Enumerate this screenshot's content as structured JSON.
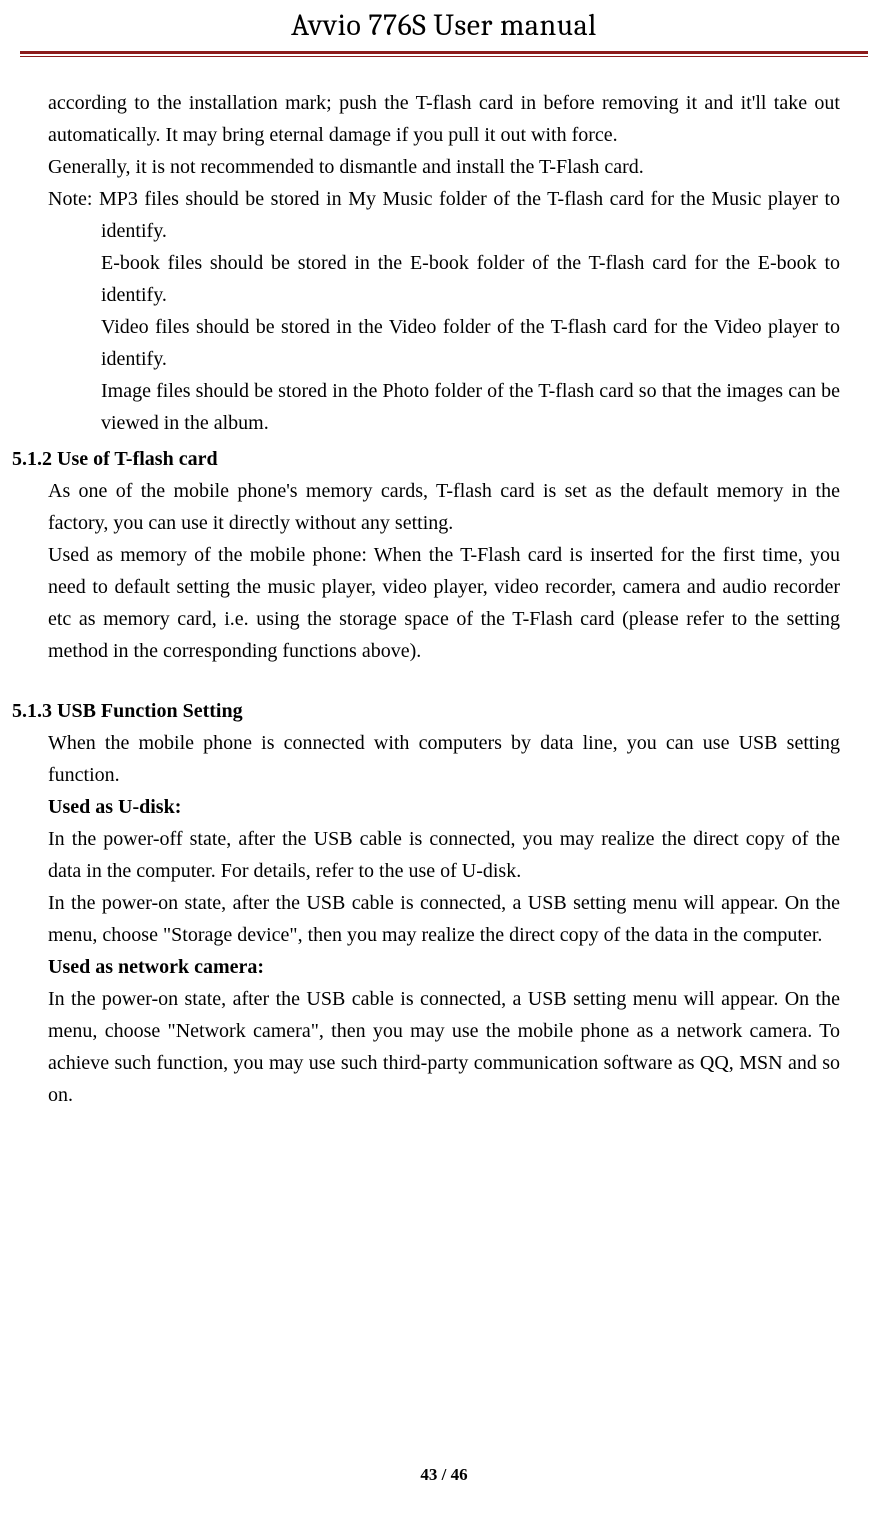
{
  "header": {
    "title": "Avvio 776S    User manual"
  },
  "body": {
    "p1": "according to the installation mark; push the T-flash card in before removing it and it'll take out automatically. It may bring eternal damage if you pull it out with force.",
    "p2": "Generally, it is not recommended to dismantle and install the T-Flash card.",
    "note1": "Note: MP3 files should be stored in My Music folder of the T-flash card for the Music player to identify.",
    "note2": "E-book files should be stored in the E-book folder of the T-flash card for the E-book to identify.",
    "note3": "Video files should be stored in the Video folder of the T-flash card for the Video player to identify.",
    "note4": "Image files should be stored in the Photo folder of the T-flash card so that the images can be viewed in the album.",
    "h512": "5.1.2 Use of T-flash card",
    "p512a": "As one of the mobile phone's memory cards, T-flash card is set as the default memory in the factory, you can use it directly without any setting.",
    "p512b": "Used as memory of the mobile phone: When the T-Flash card is inserted for the first time, you need to default setting the music player, video player, video recorder, camera and audio recorder etc as memory card, i.e. using the storage space of the T-Flash card (please refer to the setting method in the corresponding functions above).",
    "h513": "5.1.3 USB Function Setting",
    "p513a": "When the mobile phone is connected with computers by data line, you can use USB setting function.",
    "udisk_label": "Used as U-disk:",
    "p513b": "In the power-off state, after the USB cable is connected, you may realize the direct copy of the data in the computer. For details, refer to the use of U-disk.",
    "p513c": "In the power-on state, after the USB cable is connected, a USB setting menu will appear. On the menu, choose \"Storage device\", then you may realize the direct copy of the data in the computer.",
    "netcam_label": "Used as network camera:",
    "p513d": "In the power-on state, after the USB cable is connected, a USB setting menu will appear. On the menu, choose \"Network camera\", then you may use the mobile phone as a network camera. To achieve such function, you may use such third-party communication software as QQ, MSN and so on."
  },
  "footer": {
    "page": "43 / 46"
  }
}
